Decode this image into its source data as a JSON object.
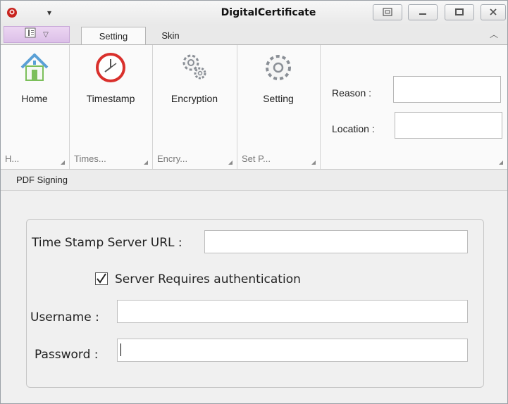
{
  "window": {
    "title": "DigitalCertificate",
    "controls": [
      "restore-app-icon",
      "minimize-icon",
      "maximize-icon",
      "close-icon"
    ]
  },
  "tabs": [
    {
      "label": "Setting",
      "active": true
    },
    {
      "label": "Skin",
      "active": false
    }
  ],
  "ribbon": {
    "buttons": [
      {
        "label": "Home",
        "icon": "home-icon"
      },
      {
        "label": "Timestamp",
        "icon": "clock-icon"
      },
      {
        "label": "Encryption",
        "icon": "gears-icon"
      },
      {
        "label": "Setting",
        "icon": "gear-icon"
      }
    ],
    "group_labels": [
      "H...",
      "Times...",
      "Encry...",
      "Set P..."
    ],
    "reason_label": "Reason :",
    "reason_value": "",
    "location_label": "Location :",
    "location_value": ""
  },
  "panel": {
    "title": "PDF Signing"
  },
  "form": {
    "tsa_url_label": "Time Stamp Server URL :",
    "tsa_url_value": "",
    "auth_checkbox_label": "Server Requires authentication",
    "auth_checked": true,
    "username_label": "Username :",
    "username_value": "",
    "password_label": "Password :",
    "password_value": ""
  },
  "colors": {
    "app_menu": "#dcc0e8",
    "accent_red": "#d9302c"
  }
}
